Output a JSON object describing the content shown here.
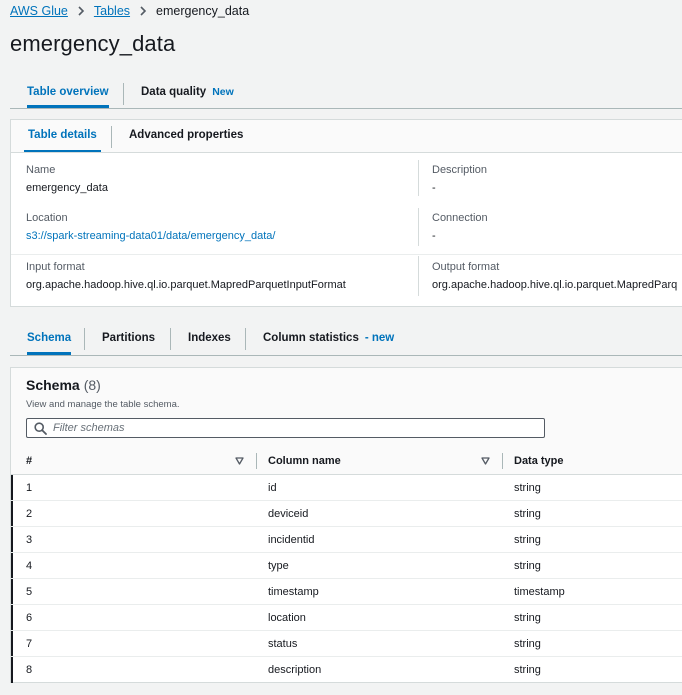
{
  "breadcrumb": {
    "items": [
      "AWS Glue",
      "Tables"
    ],
    "current": "emergency_data"
  },
  "page": {
    "title": "emergency_data"
  },
  "overview_tabs": {
    "table_overview": "Table overview",
    "data_quality": "Data quality",
    "data_quality_badge": "New"
  },
  "details_tabs": {
    "table_details": "Table details",
    "advanced_properties": "Advanced properties"
  },
  "details": {
    "name_label": "Name",
    "name_value": "emergency_data",
    "description_label": "Description",
    "description_value": "-",
    "location_label": "Location",
    "location_value": "s3://spark-streaming-data01/data/emergency_data/",
    "connection_label": "Connection",
    "connection_value": "-",
    "input_format_label": "Input format",
    "input_format_value": "org.apache.hadoop.hive.ql.io.parquet.MapredParquetInputFormat",
    "output_format_label": "Output format",
    "output_format_value": "org.apache.hadoop.hive.ql.io.parquet.MapredParq"
  },
  "schema_tabs": {
    "schema": "Schema",
    "partitions": "Partitions",
    "indexes": "Indexes",
    "column_statistics": "Column statistics",
    "column_statistics_badge": "- new"
  },
  "schema": {
    "title": "Schema",
    "count": "(8)",
    "description": "View and manage the table schema.",
    "filter_placeholder": "Filter schemas",
    "columns": [
      "#",
      "Column name",
      "Data type"
    ],
    "rows": [
      {
        "num": "1",
        "name": "id",
        "type": "string"
      },
      {
        "num": "2",
        "name": "deviceid",
        "type": "string"
      },
      {
        "num": "3",
        "name": "incidentid",
        "type": "string"
      },
      {
        "num": "4",
        "name": "type",
        "type": "string"
      },
      {
        "num": "5",
        "name": "timestamp",
        "type": "timestamp"
      },
      {
        "num": "6",
        "name": "location",
        "type": "string"
      },
      {
        "num": "7",
        "name": "status",
        "type": "string"
      },
      {
        "num": "8",
        "name": "description",
        "type": "string"
      }
    ]
  },
  "colors": {
    "link": "#0073bb",
    "text": "#16191f",
    "muted": "#545b64",
    "background": "#f2f3f3"
  }
}
